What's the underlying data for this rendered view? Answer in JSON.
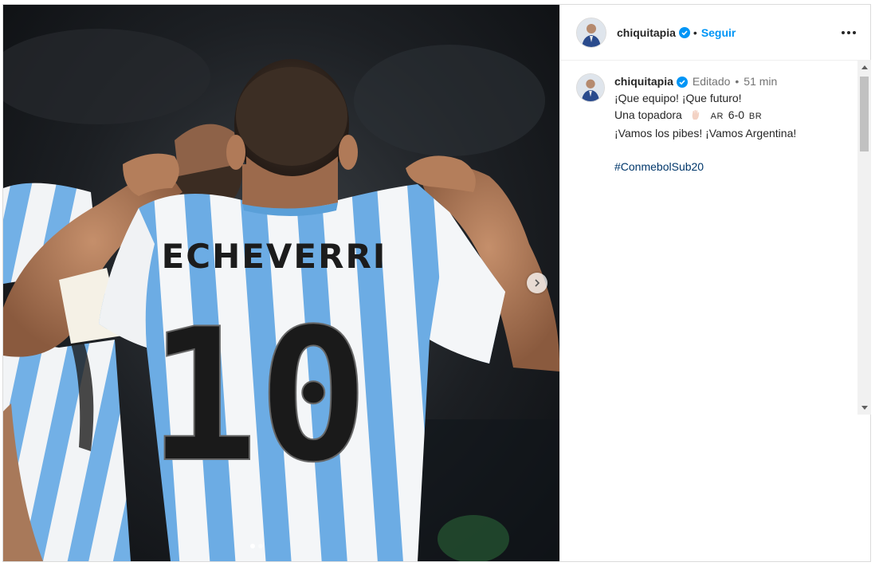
{
  "post": {
    "username": "chiquitapia",
    "follow_label": "Seguir",
    "separator": "•",
    "edited_label": "Editado",
    "bullet": "•",
    "time": "51 min",
    "caption_lines": [
      "¡Que equipo! ¡Que futuro!",
      "Una topadora",
      "¡Vamos los pibes! ¡Vamos Argentina!"
    ],
    "score": {
      "home_code": "AR",
      "score": "6-0",
      "away_code": "BR"
    },
    "hashtag": "#ConmebolSub20",
    "jersey_name": "ECHEVERRI",
    "jersey_number": "10"
  },
  "icons": {
    "verified": "verified-badge-icon",
    "more": "more-options-icon",
    "next": "chevron-right-icon",
    "hand": "hand-emoji-icon"
  },
  "colors": {
    "accent": "#0095f6",
    "verified": "#0095f6",
    "hashtag": "#00376b",
    "jersey_blue": "#6cace4"
  }
}
